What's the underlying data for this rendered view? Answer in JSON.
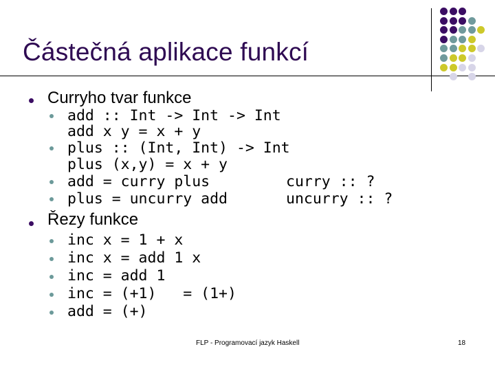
{
  "slide": {
    "title": "Částečná aplikace funkcí",
    "decoration": {
      "colors": {
        "purple": "#3b0d63",
        "teal": "#6f9a9c",
        "yellow": "#cdc92a",
        "lavender": "#d7d5e8"
      },
      "dot_grid_rows": [
        [
          "purple",
          "purple",
          "purple"
        ],
        [
          "purple",
          "purple",
          "purple",
          "teal"
        ],
        [
          "purple",
          "purple",
          "teal",
          "teal",
          "yellow"
        ],
        [
          "purple",
          "teal",
          "teal",
          "yellow"
        ],
        [
          "teal",
          "teal",
          "yellow",
          "yellow",
          "lavender"
        ],
        [
          "teal",
          "yellow",
          "yellow",
          "lavender"
        ],
        [
          "yellow",
          "yellow",
          "lavender",
          "lavender"
        ],
        [
          null,
          "lavender",
          null,
          "lavender"
        ]
      ]
    },
    "sections": [
      {
        "heading": "Curryho tvar funkce",
        "items": [
          {
            "lines": [
              "add :: Int -> Int -> Int",
              "add x y = x + y"
            ]
          },
          {
            "lines": [
              "plus :: (Int, Int) -> Int",
              "plus (x,y) = x + y"
            ]
          },
          {
            "lines": [
              "add = curry plus"
            ],
            "note": "curry :: ?"
          },
          {
            "lines": [
              "plus = uncurry add"
            ],
            "note": "uncurry :: ?"
          }
        ]
      },
      {
        "heading": "Řezy funkce",
        "items": [
          {
            "lines": [
              "inc x = 1 + x"
            ]
          },
          {
            "lines": [
              "inc x = add 1 x"
            ]
          },
          {
            "lines": [
              "inc = add 1"
            ]
          },
          {
            "lines": [
              "inc = (+1)   = (1+)"
            ]
          },
          {
            "lines": [
              "add = (+)"
            ]
          }
        ]
      }
    ],
    "footer": "FLP - Programovací jazyk Haskell",
    "page_number": "18"
  }
}
